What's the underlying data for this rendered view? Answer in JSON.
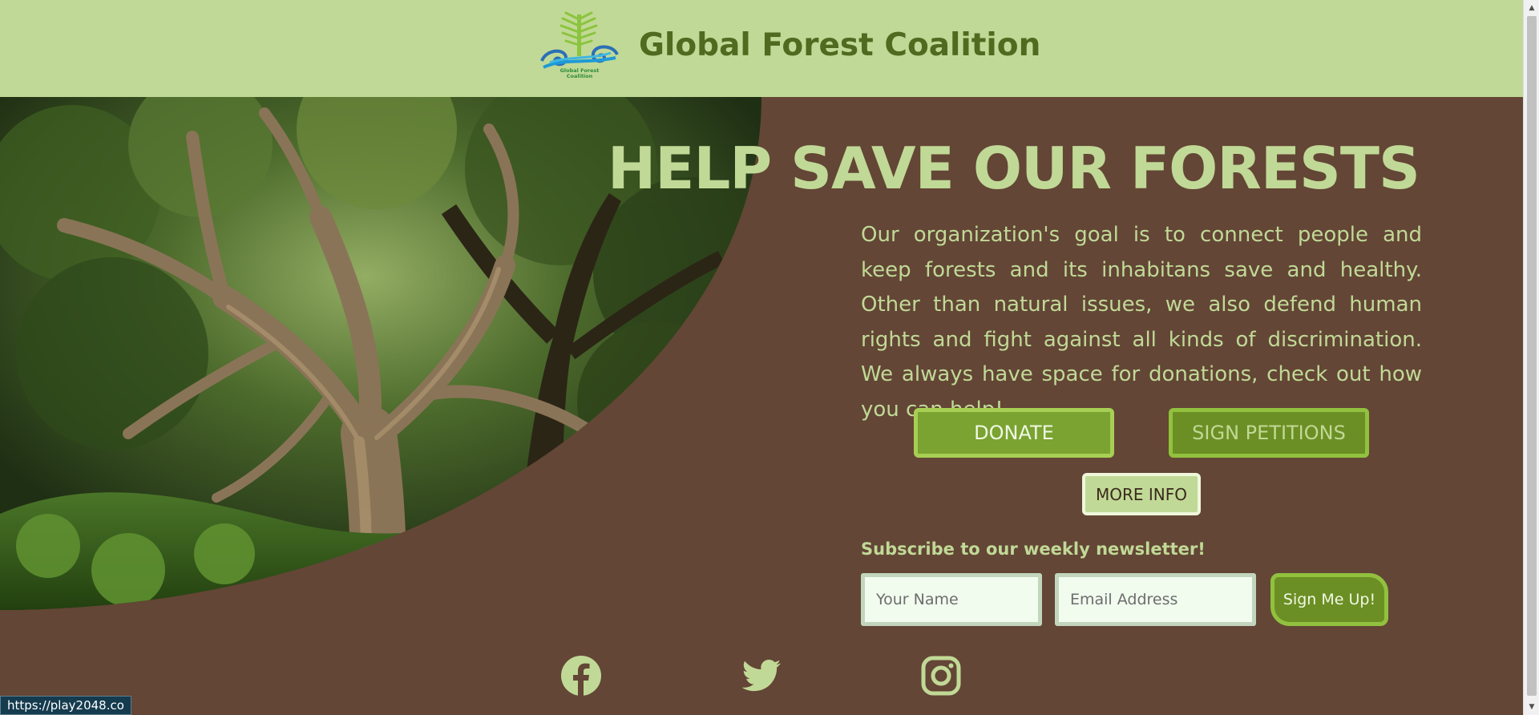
{
  "header": {
    "title": "Global Forest Coalition",
    "logo_text_line1": "Global Forest",
    "logo_text_line2": "Coalition"
  },
  "hero": {
    "heading": "HELP SAVE OUR FORESTS",
    "description": "Our organization's goal is to connect people and keep forests and its inhabitans save and healthy. Other than natural issues, we also defend human rights and fight against all kinds of discrimination. We always have space for donations, check out how you can help!",
    "image": "forest-photo"
  },
  "actions": {
    "donate_label": "DONATE",
    "petitions_label": "SIGN PETITIONS",
    "more_info_label": "MORE INFO"
  },
  "newsletter": {
    "label": "Subscribe to our weekly newsletter!",
    "name_placeholder": "Your Name",
    "name_value": "",
    "email_placeholder": "Email Address",
    "email_value": "",
    "submit_label": "Sign Me Up!"
  },
  "social": [
    {
      "name": "facebook",
      "icon": "facebook-icon"
    },
    {
      "name": "twitter",
      "icon": "twitter-icon"
    },
    {
      "name": "instagram",
      "icon": "instagram-icon"
    }
  ],
  "status_bar": {
    "url": "https://play2048.co"
  },
  "colors": {
    "header_bg": "#c1d996",
    "page_bg": "#634636",
    "accent_green": "#7aa331",
    "title_green": "#4e6b20",
    "text_light": "#c1d996"
  }
}
